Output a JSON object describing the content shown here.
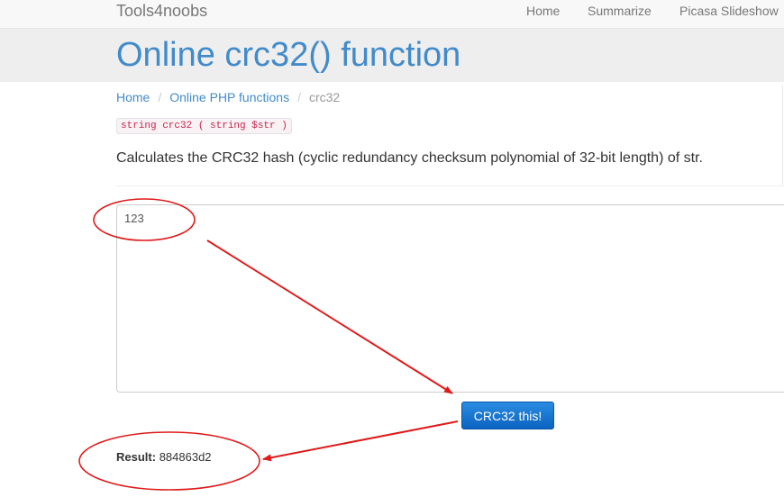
{
  "navbar": {
    "brand": "Tools4noobs",
    "links": [
      "Home",
      "Summarize",
      "Picasa Slideshow"
    ]
  },
  "header": {
    "title": "Online crc32() function"
  },
  "breadcrumb": {
    "items": [
      "Home",
      "Online PHP functions"
    ],
    "current": "crc32"
  },
  "signature": "string crc32 ( string $str )",
  "description": "Calculates the CRC32 hash (cyclic redundancy checksum polynomial of 32-bit length) of str.",
  "input": {
    "value": "123"
  },
  "submit": {
    "label": "CRC32 this!"
  },
  "result": {
    "label": "Result:",
    "value": "884863d2"
  },
  "colors": {
    "link": "#428bca",
    "button": "#0b63c1",
    "annotation": "#e01a1a"
  }
}
